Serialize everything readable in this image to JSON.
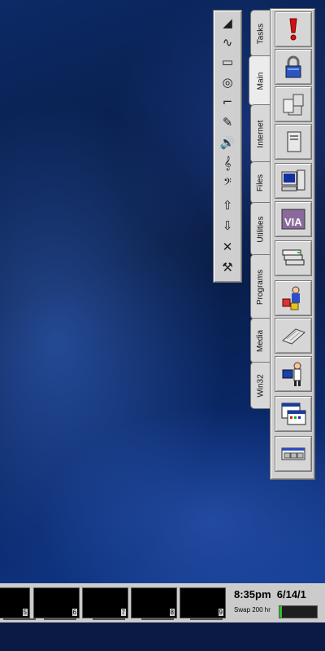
{
  "audio_strip": {
    "buttons": [
      {
        "name": "volume-ramp-icon",
        "glyph": "◢"
      },
      {
        "name": "waveform-icon",
        "glyph": "∿"
      },
      {
        "name": "ruler-icon",
        "glyph": "▭"
      },
      {
        "name": "cd-icon",
        "glyph": "◎"
      },
      {
        "name": "headphone-plug-icon",
        "glyph": "⌐"
      },
      {
        "name": "microphone-icon",
        "glyph": "✎"
      },
      {
        "name": "speaker-icon",
        "glyph": "🔊"
      },
      {
        "name": "treble-clef-icon",
        "glyph": "𝄞"
      },
      {
        "name": "bass-clef-icon",
        "glyph": "𝄢"
      },
      {
        "name": "arrow-up-icon",
        "glyph": "⇧"
      },
      {
        "name": "arrow-down-icon",
        "glyph": "⇩"
      },
      {
        "name": "close-icon",
        "glyph": "✕"
      },
      {
        "name": "tools-icon",
        "glyph": "⚒"
      }
    ]
  },
  "tabs": [
    {
      "label": "Tasks"
    },
    {
      "label": "Main"
    },
    {
      "label": "Internet"
    },
    {
      "label": "Files"
    },
    {
      "label": "Utilities"
    },
    {
      "label": "Programs"
    },
    {
      "label": "Media"
    },
    {
      "label": "Win32"
    }
  ],
  "panel_buttons": [
    {
      "name": "alert-icon"
    },
    {
      "name": "padlock-icon"
    },
    {
      "name": "network-icon"
    },
    {
      "name": "server-icon"
    },
    {
      "name": "workstation-icon"
    },
    {
      "name": "via-logo-icon"
    },
    {
      "name": "printer-stack-icon"
    },
    {
      "name": "person-packages-icon"
    },
    {
      "name": "keyboard-icon"
    },
    {
      "name": "presenter-icon"
    },
    {
      "name": "terminal-window-icon"
    },
    {
      "name": "window-bar-icon"
    }
  ],
  "taskbar": {
    "desktops": [
      "5",
      "6",
      "7",
      "8",
      "9"
    ],
    "clock": "8:35pm  6/14/1",
    "swap_label": "Swap 200 hr",
    "swap_fraction": 0.06
  },
  "colors": {
    "panel_bg": "#cfcfcf",
    "swap_green": "#2fbf2f"
  }
}
